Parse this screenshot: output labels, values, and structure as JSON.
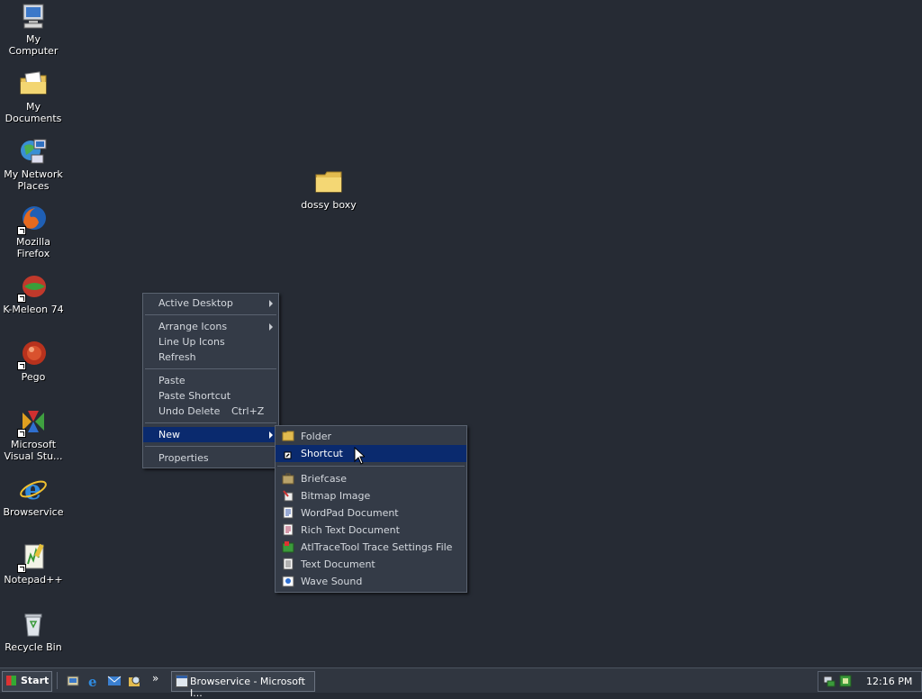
{
  "desktop": {
    "icons": [
      {
        "label": "My Computer",
        "icon": "computer-icon"
      },
      {
        "label": "My Documents",
        "icon": "documents-folder-icon"
      },
      {
        "label": "My Network Places",
        "icon": "network-places-icon"
      },
      {
        "label": "Mozilla Firefox",
        "icon": "firefox-icon"
      },
      {
        "label": "K-Meleon 74",
        "icon": "kmeleon-icon"
      },
      {
        "label": "Pego",
        "icon": "pego-icon"
      },
      {
        "label": "Microsoft Visual Stu...",
        "icon": "visual-studio-icon"
      },
      {
        "label": "Browservice",
        "icon": "internet-explorer-icon"
      },
      {
        "label": "Notepad++",
        "icon": "notepadpp-icon"
      },
      {
        "label": "Recycle Bin",
        "icon": "recycle-bin-icon"
      }
    ],
    "folder": {
      "label": "dossy boxy",
      "icon": "folder-icon"
    }
  },
  "context_menu": {
    "items": [
      {
        "label": "Active Desktop",
        "submenu": true
      },
      {
        "label": "Arrange Icons",
        "submenu": true
      },
      {
        "label": "Line Up Icons"
      },
      {
        "label": "Refresh"
      },
      {
        "label": "Paste"
      },
      {
        "label": "Paste Shortcut"
      },
      {
        "label": "Undo Delete",
        "shortcut": "Ctrl+Z"
      },
      {
        "label": "New",
        "submenu": true,
        "highlighted": true
      },
      {
        "label": "Properties"
      }
    ]
  },
  "new_submenu": {
    "items": [
      {
        "label": "Folder",
        "icon": "folder-icon"
      },
      {
        "label": "Shortcut",
        "icon": "shortcut-icon",
        "highlighted": true
      },
      {
        "label": "Briefcase",
        "icon": "briefcase-icon"
      },
      {
        "label": "Bitmap Image",
        "icon": "bitmap-icon"
      },
      {
        "label": "WordPad Document",
        "icon": "wordpad-icon"
      },
      {
        "label": "Rich Text Document",
        "icon": "rich-text-icon"
      },
      {
        "label": "AtlTraceTool Trace Settings File",
        "icon": "trace-settings-icon"
      },
      {
        "label": "Text Document",
        "icon": "text-document-icon"
      },
      {
        "label": "Wave Sound",
        "icon": "wave-sound-icon"
      }
    ]
  },
  "taskbar": {
    "start_label": "Start",
    "overflow": "»",
    "task_label": "Browservice - Microsoft I...",
    "clock": "12:16 PM"
  },
  "colors": {
    "desktop": "#262b34",
    "menu_bg": "#343b47",
    "highlight": "#0a2a6e"
  }
}
